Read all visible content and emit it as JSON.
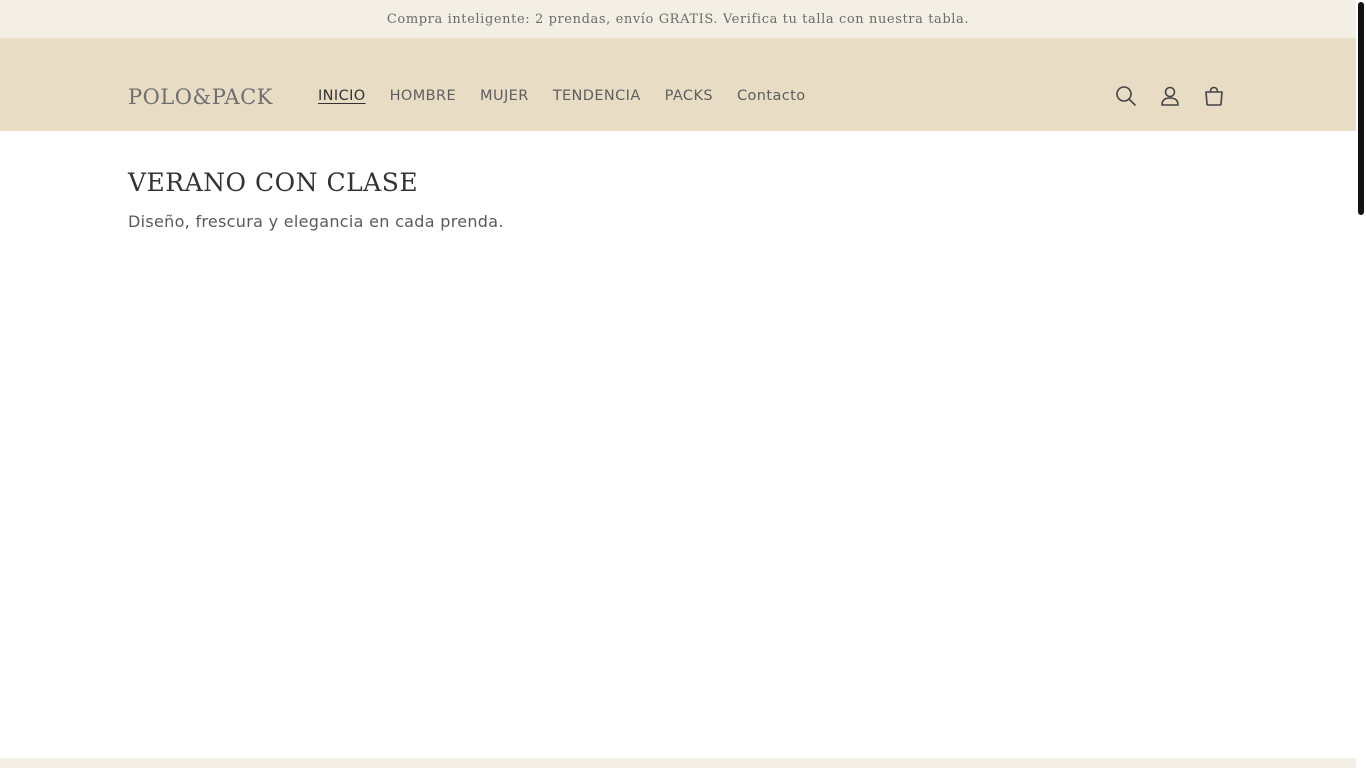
{
  "announcement": {
    "text": "Compra inteligente: 2 prendas, envío GRATIS. Verifica tu talla con nuestra tabla."
  },
  "header": {
    "logo": "POLO&PACK",
    "nav": [
      {
        "label": "INICIO",
        "active": true
      },
      {
        "label": "HOMBRE",
        "active": false
      },
      {
        "label": "MUJER",
        "active": false
      },
      {
        "label": "TENDENCIA",
        "active": false
      },
      {
        "label": "PACKS",
        "active": false
      },
      {
        "label": "Contacto",
        "active": false
      }
    ],
    "icons": [
      "search-icon",
      "account-icon",
      "cart-icon"
    ]
  },
  "hero": {
    "title": "VERANO CON CLASE",
    "subtitle": "Diseño, frescura y elegancia en cada prenda."
  },
  "colors": {
    "announcement_bg": "#f4efe5",
    "header_bg": "#e8dcc5",
    "text": "#4a4a4a"
  }
}
